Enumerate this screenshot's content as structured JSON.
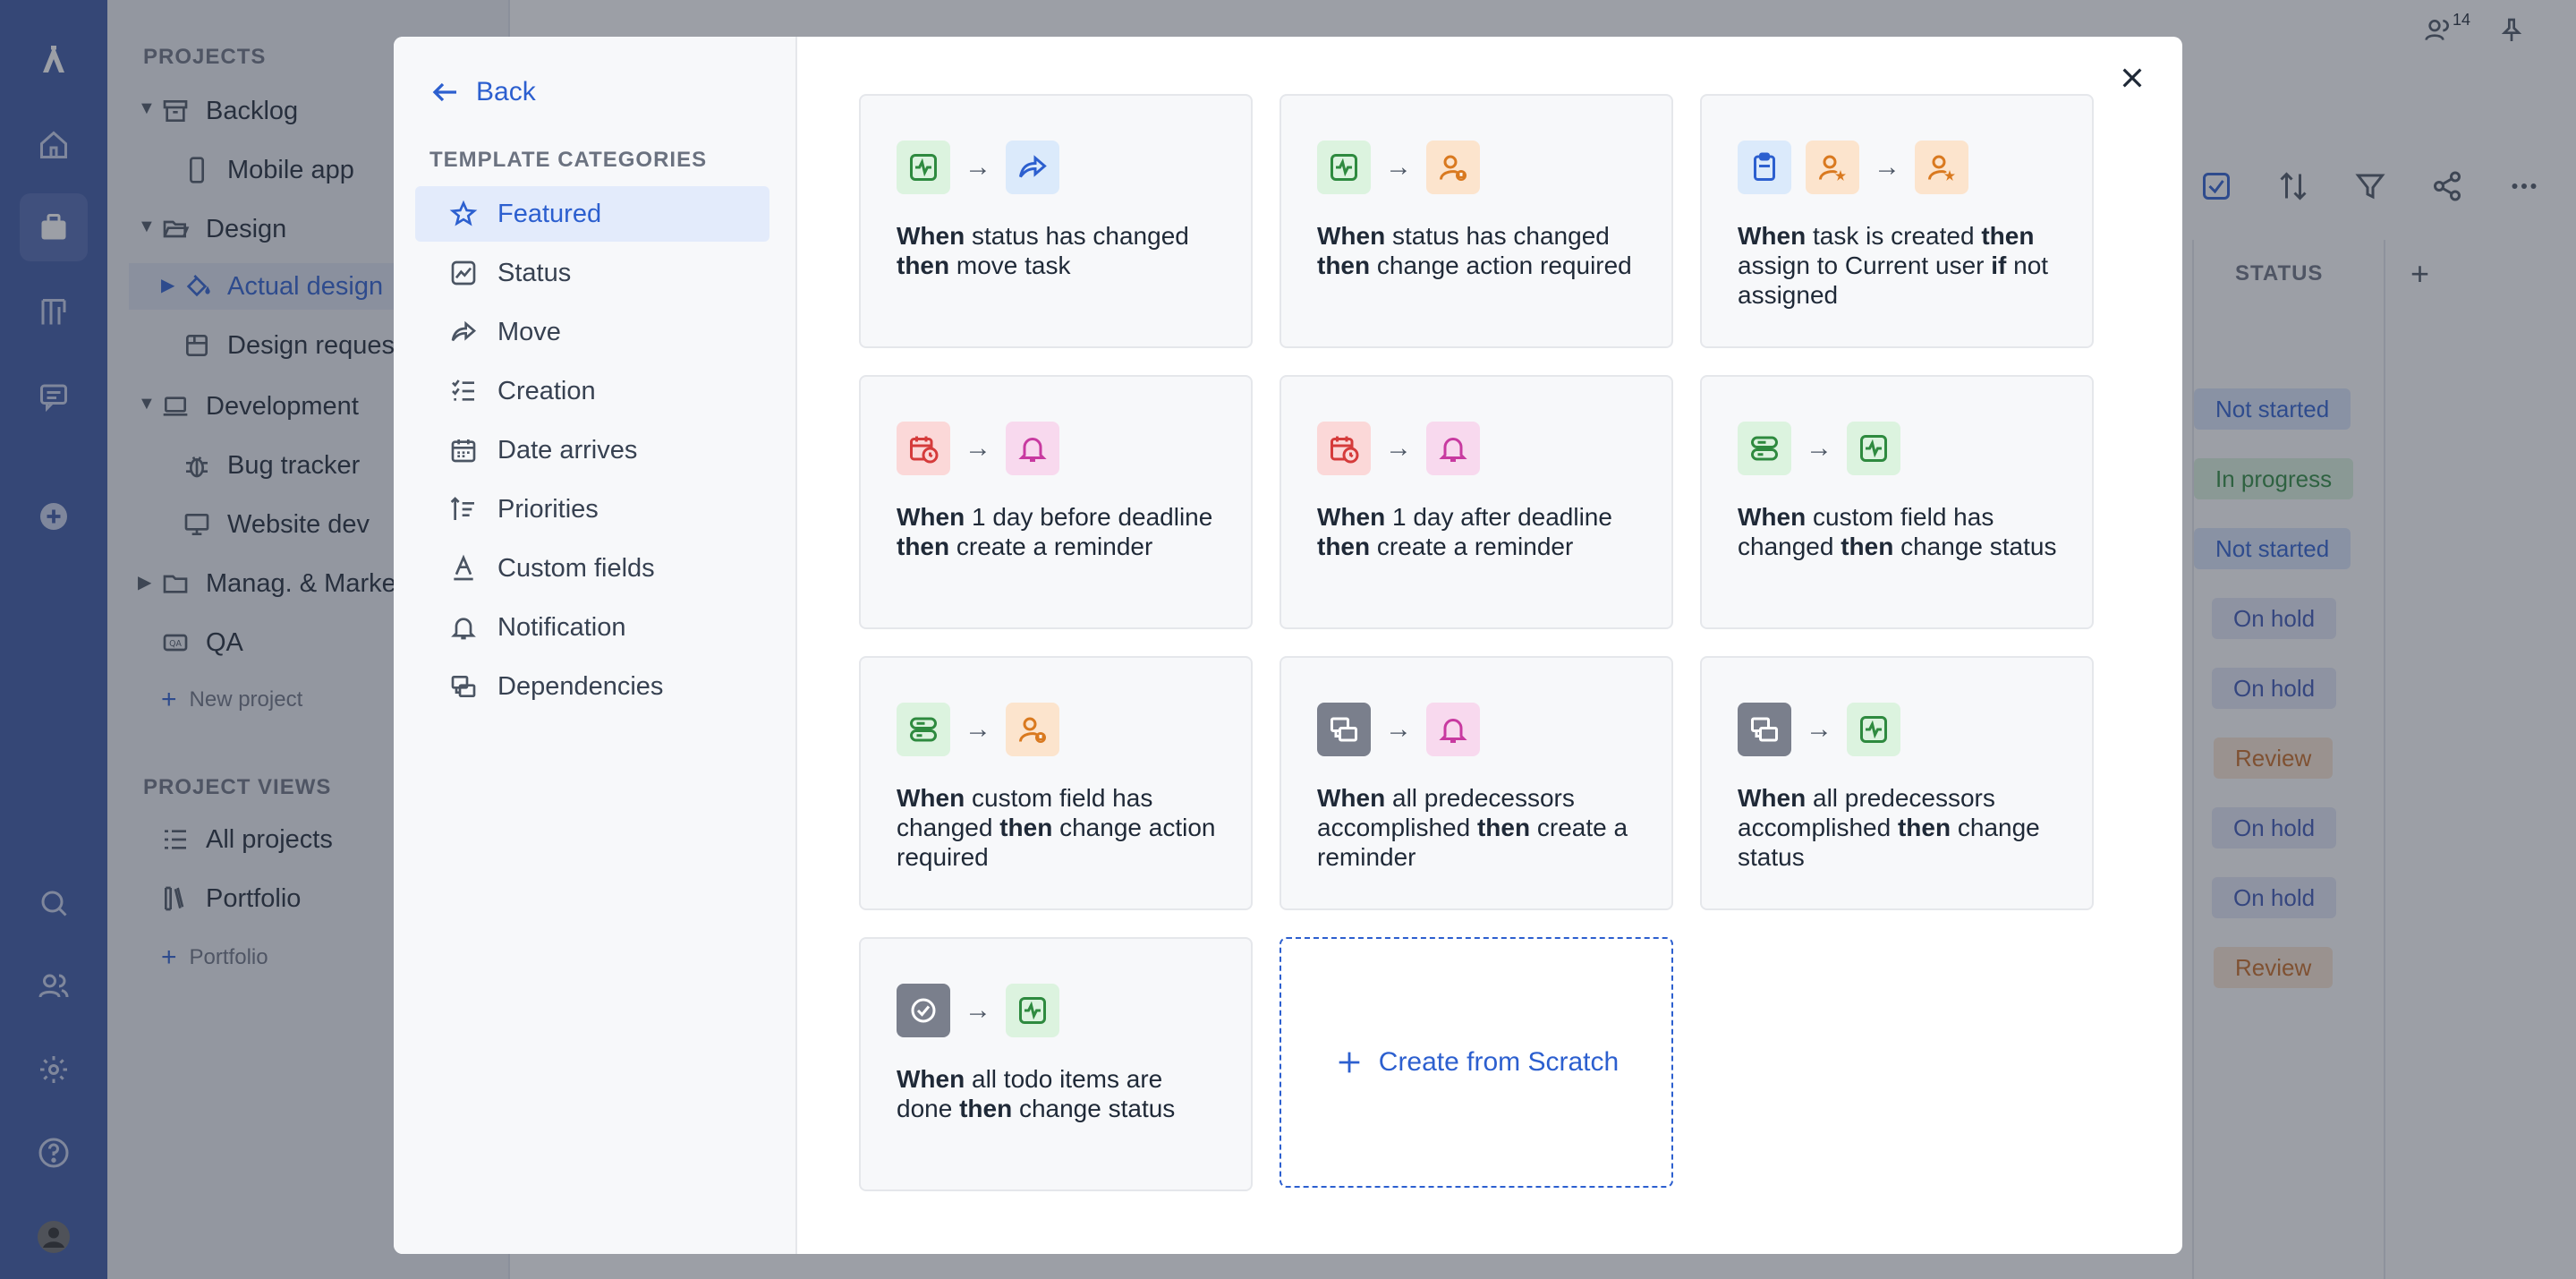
{
  "projects": {
    "header": "PROJECTS",
    "items": [
      {
        "label": "Backlog"
      },
      {
        "label": "Mobile app"
      },
      {
        "label": "Design"
      },
      {
        "label": "Actual design"
      },
      {
        "label": "Design reques"
      },
      {
        "label": "Development"
      },
      {
        "label": "Bug tracker"
      },
      {
        "label": "Website dev"
      },
      {
        "label": "Manag. & Marke"
      },
      {
        "label": "QA"
      }
    ],
    "new_project": "New project",
    "views_header": "PROJECT VIEWS",
    "views": [
      {
        "label": "All projects"
      },
      {
        "label": "Portfolio"
      }
    ],
    "new_portfolio": "Portfolio"
  },
  "header": {
    "members_count": "14"
  },
  "table": {
    "status_header": "STATUS",
    "statuses": [
      "Not started",
      "In progress",
      "Not started",
      "On hold",
      "On hold",
      "Review",
      "On hold",
      "On hold",
      "Review"
    ]
  },
  "modal": {
    "back_label": "Back",
    "categories_title": "TEMPLATE CATEGORIES",
    "categories": [
      "Featured",
      "Status",
      "Move",
      "Creation",
      "Date arrives",
      "Priorities",
      "Custom fields",
      "Notification",
      "Dependencies"
    ],
    "templates": [
      {
        "parts": [
          "When",
          " status has changed ",
          "then",
          " move task"
        ]
      },
      {
        "parts": [
          "When",
          " status has changed ",
          "then",
          " change action required"
        ]
      },
      {
        "parts": [
          "When",
          " task is created ",
          "then",
          " assign to Current user ",
          "if",
          " not assigned"
        ]
      },
      {
        "parts": [
          "When",
          " 1 day before deadline ",
          "then",
          " create a reminder"
        ]
      },
      {
        "parts": [
          "When",
          " 1 day after deadline ",
          "then",
          " create a reminder"
        ]
      },
      {
        "parts": [
          "When",
          " custom field has changed ",
          "then",
          " change status"
        ]
      },
      {
        "parts": [
          "When",
          " custom field has changed ",
          "then",
          " change action required"
        ]
      },
      {
        "parts": [
          "When",
          " all predecessors accomplished ",
          "then",
          " create a reminder"
        ]
      },
      {
        "parts": [
          "When",
          " all predecessors accomplished ",
          "then",
          " change status"
        ]
      },
      {
        "parts": [
          "When",
          " all todo items are done ",
          "then",
          " change status"
        ]
      }
    ],
    "arrow": "→",
    "scratch_label": "Create from Scratch"
  }
}
